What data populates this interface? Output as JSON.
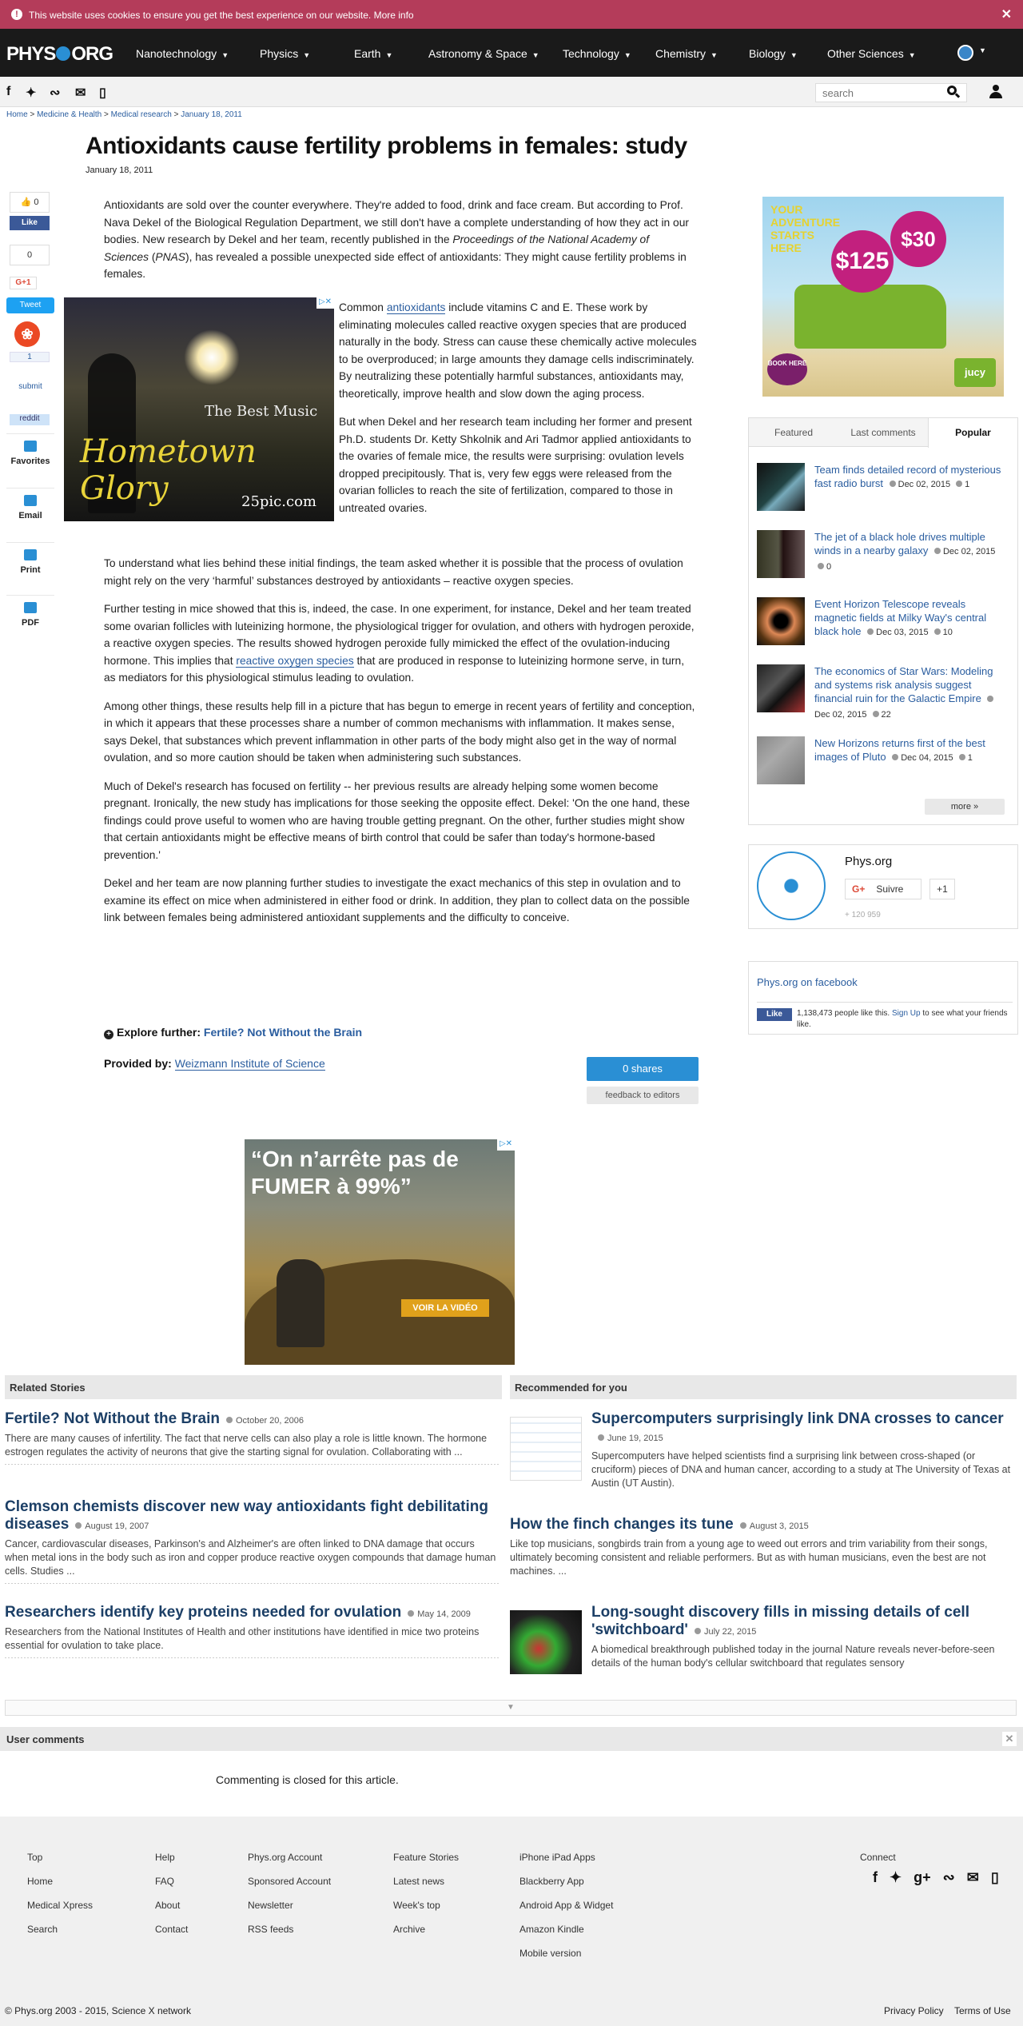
{
  "cookie_bar": {
    "message": "This website uses cookies to ensure you get the best experience on our website. More info",
    "close": "✕"
  },
  "nav": {
    "logo": "PHYS",
    "logo_suffix": "ORG",
    "items": [
      "Nanotechnology",
      "Physics",
      "Earth",
      "Astronomy & Space",
      "Technology",
      "Chemistry",
      "Biology",
      "Other Sciences"
    ]
  },
  "toolbar": {
    "search_placeholder": "search"
  },
  "breadcrumb": {
    "home": "Home",
    "section": "Medicine & Health",
    "sub": "Medical research",
    "date": "January 18, 2011"
  },
  "article": {
    "title": "Antioxidants cause fertility problems in females: study",
    "date": "January 18, 2011",
    "p1a": "Antioxidants are sold over the counter everywhere. They're added to food, drink and face cream. But according to Prof. Nava Dekel of the Biological Regulation Department, we still don't have a complete understanding of how they act in our bodies. New research by Dekel and her team, recently published in the ",
    "p1_journal": "Proceedings of the National Academy of Sciences",
    "p1b": " (",
    "p1_pnas": "PNAS",
    "p1c": "), has revealed a possible unexpected side effect of antioxidants: They might cause fertility problems in females.",
    "p2a": "Common ",
    "p2_link": "antioxidants",
    "p2b": " include vitamins C and E. These work by eliminating molecules called reactive oxygen species that are produced naturally in the body. Stress can cause these chemically active molecules to be overproduced; in large amounts they damage cells indiscriminately. By neutralizing these potentially harmful substances, antioxidants may, theoretically, improve health and slow down the aging process.",
    "p3": "But when Dekel and her research team including her former and present Ph.D. students Dr. Ketty Shkolnik and Ari Tadmor applied antioxidants to the ovaries of female mice, the results were surprising: ovulation levels dropped precipitously. That is, very few eggs were released from the ovarian follicles to reach the site of fertilization, compared to those in untreated ovaries.",
    "p4": "To understand what lies behind these initial findings, the team asked whether it is possible that the process of ovulation might rely on the very ‘harmful’ substances destroyed by antioxidants – reactive oxygen species.",
    "p5a": "Further testing in mice showed that this is, indeed, the case. In one experiment, for instance, Dekel and her team treated some ovarian follicles with luteinizing hormone, the physiological trigger for ovulation, and others with hydrogen peroxide, a reactive oxygen species. The results showed hydrogen peroxide fully mimicked the effect of the ovulation-inducing hormone. This implies that ",
    "p5_link": "reactive oxygen species",
    "p5b": " that are produced in response to luteinizing hormone serve, in turn, as mediators for this physiological stimulus leading to ovulation.",
    "p6": "Among other things, these results help fill in a picture that has begun to emerge in recent years of fertility and conception, in which it appears that these processes share a number of common mechanisms with inflammation. It makes sense, says Dekel, that substances which prevent inflammation in other parts of the body might also get in the way of normal ovulation, and so more caution should be taken when administering such substances.",
    "p7": "Much of Dekel's research has focused on fertility -- her previous results are already helping some women become pregnant. Ironically, the new study has implications for those seeking the opposite effect. Dekel: 'On the one hand, these findings could prove useful to women who are having trouble getting pregnant. On the other, further studies might show that certain antioxidants might be effective means of birth control that could be safer than today's hormone-based prevention.'",
    "p8": "Dekel and her team are now planning further studies to investigate the exact mechanics of this step in ovulation and to examine its effect on mice when administered in either food or drink. In addition, they plan to collect data on the possible link between females being administered antioxidant supplements and the difficulty to conceive.",
    "explore_label": "Explore further:",
    "explore_link": "Fertile? Not Without the Brain",
    "provided_label": "Provided by:",
    "provided_link": "Weizmann Institute of Science",
    "shares": "0 shares",
    "feedback": "feedback to editors"
  },
  "social": {
    "like_count": "0",
    "fb_like": "Like",
    "gplus_count": "0",
    "gplus": "G+1",
    "tweet": "Tweet",
    "su_count": "1",
    "submit": "submit",
    "reddit": "reddit",
    "favorites": "Favorites",
    "email": "Email",
    "print": "Print",
    "pdf": "PDF"
  },
  "ad_left": {
    "line1": "The Best Music",
    "line2": "Hometown Glory",
    "line3": "25pic.com"
  },
  "ad_bottom": {
    "quote": "“On n’arrête pas de FUMER à 99%”",
    "button": "VOIR LA VIDÉO"
  },
  "ad_right": {
    "tagline": "YOUR ADVENTURE STARTS HERE",
    "price1": "$125",
    "price2": "$30",
    "book": "BOOK HERE",
    "brand": "jucy"
  },
  "tabs": {
    "labels": [
      "Featured",
      "Last comments",
      "Popular"
    ],
    "items": [
      {
        "title": "Team finds detailed record of mysterious fast radio burst",
        "date": "Dec 02, 2015",
        "comments": "1"
      },
      {
        "title": "The jet of a black hole drives multiple winds in a nearby galaxy",
        "date": "Dec 02, 2015",
        "comments": "0"
      },
      {
        "title": "Event Horizon Telescope reveals magnetic fields at Milky Way's central black hole",
        "date": "Dec 03, 2015",
        "comments": "10"
      },
      {
        "title": "The economics of Star Wars: Modeling and systems risk analysis suggest financial ruin for the Galactic Empire",
        "date": "Dec 02, 2015",
        "comments": "22"
      },
      {
        "title": "New Horizons returns first of the best images of Pluto",
        "date": "Dec 04, 2015",
        "comments": "1"
      }
    ],
    "more": "more »"
  },
  "physbox": {
    "name": "Phys.org",
    "follow": "Suivre",
    "plus": "+1",
    "count": "+ 120 959"
  },
  "fbbox": {
    "title": "Phys.org on facebook",
    "like": "Like",
    "people": "1,138,473 people like this.",
    "signup": "Sign Up",
    "rest": "to see what your friends like."
  },
  "related": {
    "header": "Related Stories",
    "items": [
      {
        "title": "Fertile? Not Without the Brain",
        "date": "October 20, 2006",
        "body": "There are many causes of infertility. The fact that nerve cells can also play a role is little known. The hormone estrogen regulates the activity of neurons that give the starting signal for ovulation. Collaborating with ..."
      },
      {
        "title": "Clemson chemists discover new way antioxidants fight debilitating diseases",
        "date": "August 19, 2007",
        "body": "Cancer, cardiovascular diseases, Parkinson's and Alzheimer's are often linked to DNA damage that occurs when metal ions in the body such as iron and copper produce reactive oxygen compounds that damage human cells. Studies ..."
      },
      {
        "title": "Researchers identify key proteins needed for ovulation",
        "date": "May 14, 2009",
        "body": "Researchers from the National Institutes of Health and other institutions have identified in mice two proteins essential for ovulation to take place."
      }
    ]
  },
  "recommended": {
    "header": "Recommended for you",
    "items": [
      {
        "title": "Supercomputers surprisingly link DNA crosses to cancer",
        "date": "June 19, 2015",
        "body": "Supercomputers have helped scientists find a surprising link between cross-shaped (or cruciform) pieces of DNA and human cancer, according to a study at The University of Texas at Austin (UT Austin)."
      },
      {
        "title": "How the finch changes its tune",
        "date": "August 3, 2015",
        "body": "Like top musicians, songbirds train from a young age to weed out errors and trim variability from their songs, ultimately becoming consistent and reliable performers. But as with human musicians, even the best are not machines. ..."
      },
      {
        "title": "Long-sought discovery fills in missing details of cell 'switchboard'",
        "date": "July 22, 2015",
        "body": "A biomedical breakthrough published today in the journal Nature reveals never-before-seen details of the human body's cellular switchboard that regulates sensory"
      }
    ]
  },
  "comments": {
    "header": "User comments",
    "closed": "Commenting is closed for this article."
  },
  "footer": {
    "col1": [
      "Top",
      "Home",
      "Medical Xpress",
      "Search"
    ],
    "col2": [
      "Help",
      "FAQ",
      "About",
      "Contact"
    ],
    "col3": [
      "Phys.org Account",
      "Sponsored Account",
      "Newsletter",
      "RSS feeds"
    ],
    "col4": [
      "Feature Stories",
      "Latest news",
      "Week's top",
      "Archive"
    ],
    "col5": [
      "iPhone iPad Apps",
      "Blackberry App",
      "Android App & Widget",
      "Amazon Kindle",
      "Mobile version"
    ],
    "connect": "Connect",
    "copyright": "© Phys.org 2003 - 2015, Science X network",
    "privacy": "Privacy Policy",
    "terms": "Terms of Use"
  }
}
